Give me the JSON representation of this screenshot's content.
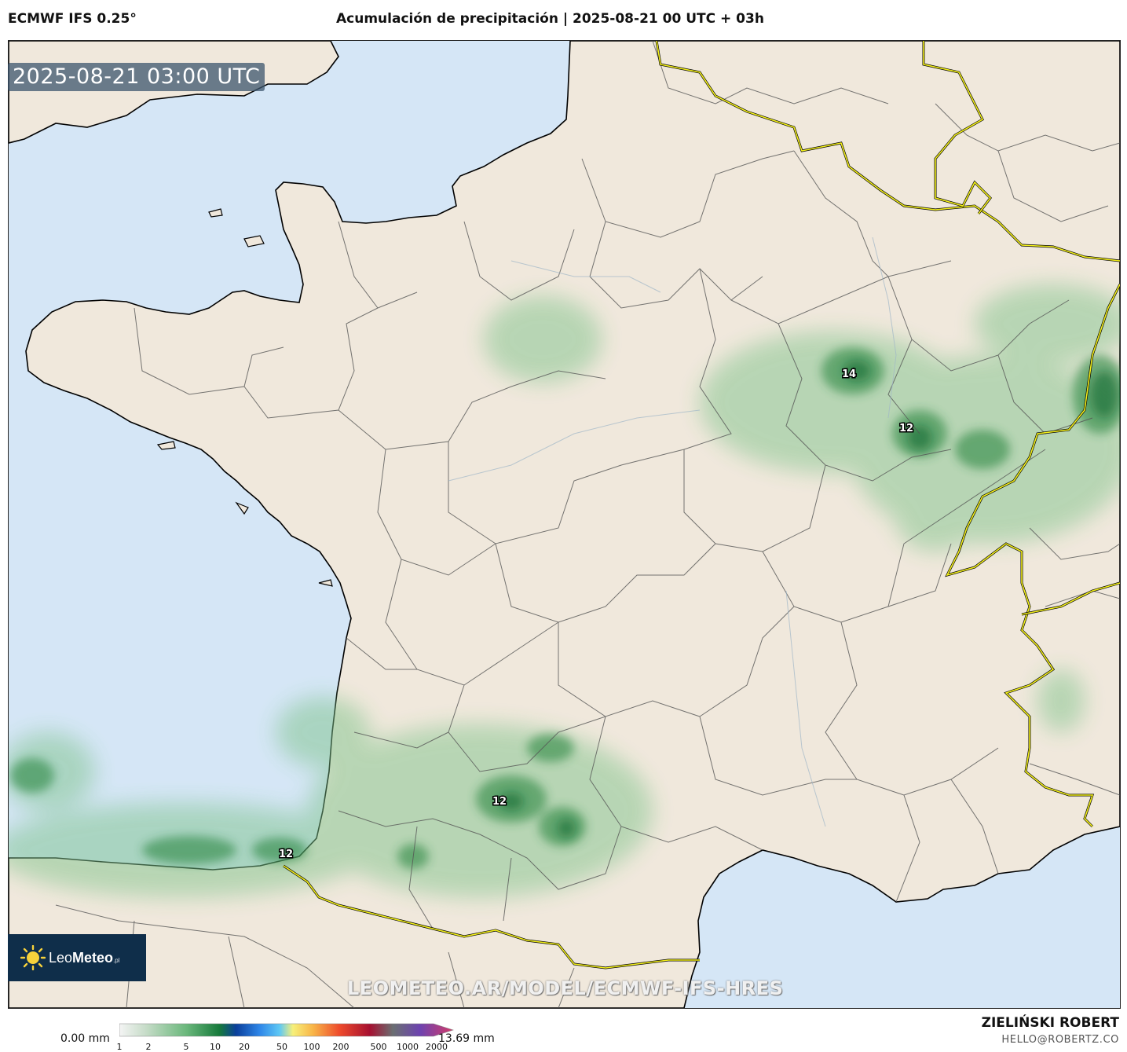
{
  "header": {
    "model": "ECMWF IFS 0.25°",
    "title": "Acumulación de precipitación | 2025-08-21 00 UTC + 03h"
  },
  "map": {
    "valid_time": "2025-08-21 03:00 UTC",
    "value_labels": [
      "14",
      "12",
      "12",
      "12"
    ]
  },
  "logo": {
    "name_part1": "Leo",
    "name_part2": "Meteo",
    "suffix": ".pl"
  },
  "watermark": "LEOMETEO.AR/MODEL/ECMWF-IFS-HRES",
  "colorbar": {
    "min_label": "0.00 mm",
    "max_label": "13.69 mm",
    "ticks": [
      "1",
      "2",
      "5",
      "10",
      "20",
      "50",
      "100",
      "200",
      "500",
      "1000",
      "2000"
    ]
  },
  "footer": {
    "author": "ZIELIŃSKI ROBERT",
    "email": "HELLO@ROBERTZ.CO"
  },
  "colors": {
    "land": "#f0e8dc",
    "sea": "#d5e6f6",
    "border": "#f4f01a",
    "rain": "#3a9a4f"
  }
}
